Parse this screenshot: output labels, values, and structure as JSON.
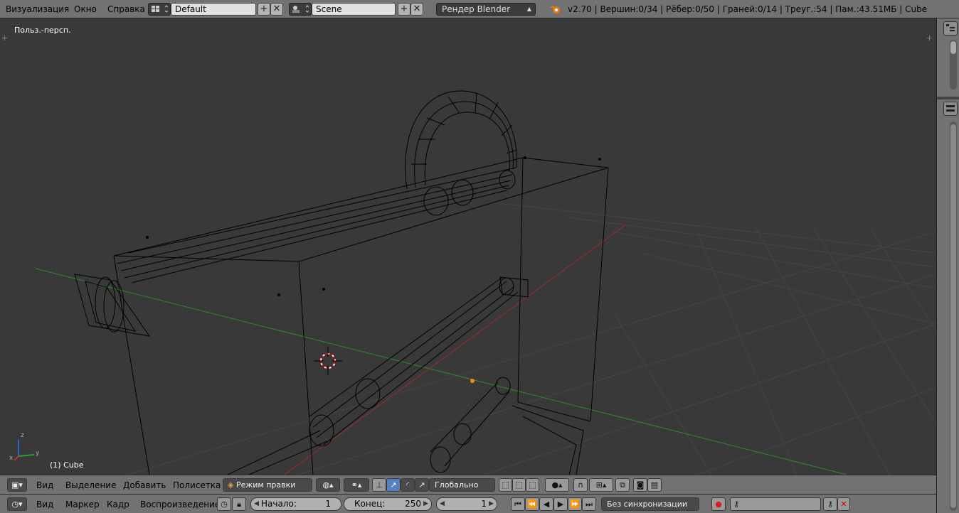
{
  "topbar": {
    "menus": [
      "Визуализация",
      "Окно",
      "Справка"
    ],
    "layout_name": "Default",
    "scene_name": "Scene",
    "render_engine": "Рендер Blender",
    "stats": "v2.70 | Вершин:0/34 | Рёбер:0/50 | Граней:0/14 | Треуг.:54 | Пам.:43.51МБ | Cube"
  },
  "viewport": {
    "view_label": "Польз.-персп.",
    "object_label": "(1) Cube",
    "axis_x": "x",
    "axis_y": "y",
    "axis_z": "z"
  },
  "header3d": {
    "menus": [
      "Вид",
      "Выделение",
      "Добавить",
      "Полисетка"
    ],
    "mode": "Режим правки",
    "orientation": "Глобально"
  },
  "timeline": {
    "menus": [
      "Вид",
      "Маркер",
      "Кадр",
      "Воспроизведение"
    ],
    "start_label": "Начало:",
    "start_value": "1",
    "end_label": "Конец:",
    "end_value": "250",
    "current_frame": "1",
    "sync": "Без синхронизации"
  },
  "colors": {
    "header": "#727272",
    "viewport_bg": "#393939",
    "x_axis": "#9b2d2d",
    "y_axis": "#2e8b2e",
    "wire": "#000000",
    "accent_blue": "#5680c2"
  }
}
